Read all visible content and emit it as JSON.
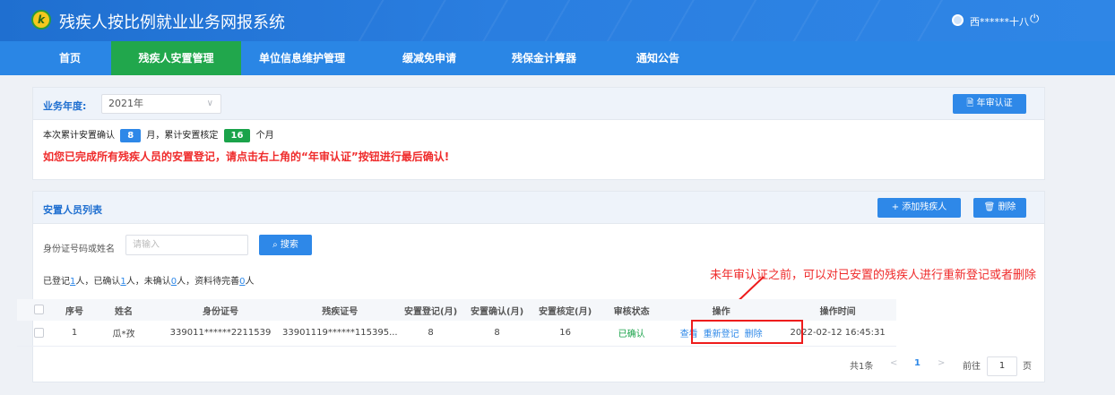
{
  "app": {
    "title": "残疾人按比例就业业务网报系统",
    "logo_text": "k",
    "user_name": "西******十八"
  },
  "nav": {
    "items": [
      {
        "label": "首页",
        "active": false
      },
      {
        "label": "残疾人安置管理",
        "active": true
      },
      {
        "label": "单位信息维护管理",
        "active": false
      },
      {
        "label": "缓减免申请",
        "active": false
      },
      {
        "label": "残保金计算器",
        "active": false
      },
      {
        "label": "通知公告",
        "active": false
      }
    ]
  },
  "year_panel": {
    "label": "业务年度:",
    "year_value": "2021年",
    "annual_button": "年审认证",
    "count_prefix": "本次累计安置确认",
    "confirm_months": "8",
    "count_mid": "月，累计安置核定",
    "verify_months": "16",
    "count_suffix": "个月",
    "warning": "如您已完成所有残疾人员的安置登记，请点击右上角的“年审认证”按钮进行最后确认!"
  },
  "list_panel": {
    "title": "安置人员列表",
    "add_button": "+ 添加残疾人",
    "delete_button": "删除",
    "search_label": "身份证号码或姓名",
    "search_placeholder": "请输入",
    "search_button": "搜索",
    "stats": {
      "t1": "已登记",
      "v1": "1",
      "t2": "人，已确认",
      "v2": "1",
      "t3": "人，未确认",
      "v3": "0",
      "t4": "人，资料待完善",
      "v4": "0",
      "t5": "人"
    }
  },
  "annotation": "未年审认证之前，可以对已安置的残疾人进行重新登记或者删除",
  "table": {
    "headers": [
      "序号",
      "姓名",
      "身份证号",
      "残疾证号",
      "安置登记(月)",
      "安置确认(月)",
      "安置核定(月)",
      "审核状态",
      "操作",
      "操作时间"
    ],
    "rows": [
      {
        "index": "1",
        "name": "瓜*孜",
        "id_no": "339011******2211539",
        "card_no": "33901119******115395...",
        "reg_months": "8",
        "confirm_months": "8",
        "verify_months": "16",
        "status": "已确认",
        "op_view": "查看",
        "op_rereg": "重新登记",
        "op_delete": "删除",
        "op_time": "2022-02-12 16:45:31"
      }
    ]
  },
  "pager": {
    "total": "共1条",
    "prev": "<",
    "current": "1",
    "next": ">",
    "goto_label": "前往",
    "goto_value": "1",
    "page_unit": "页"
  },
  "colors": {
    "header_blue": "#1f6fd0",
    "nav_blue": "#2a86e5",
    "active_green": "#21a74c",
    "button_blue": "#2e88e8",
    "warning_red": "#ef2b2b"
  }
}
